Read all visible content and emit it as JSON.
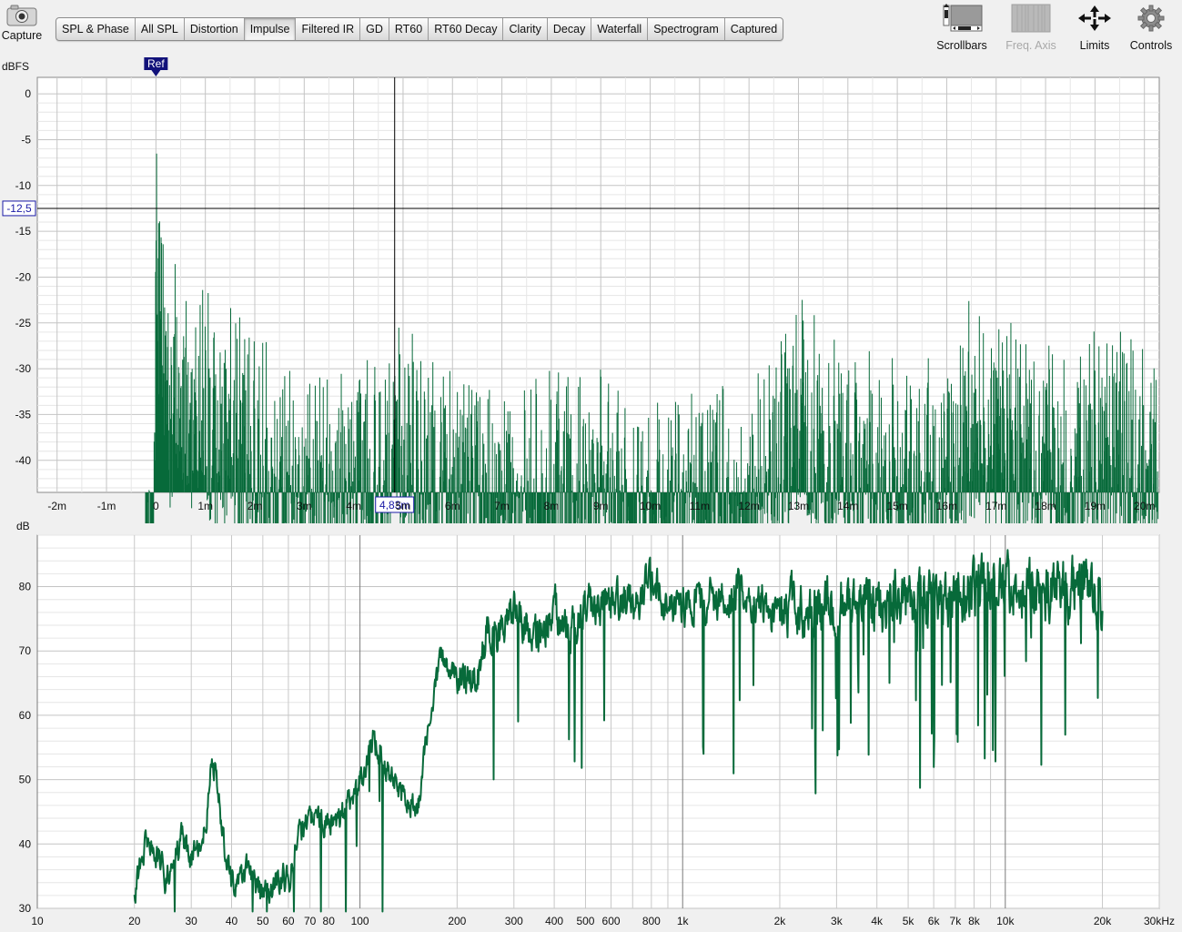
{
  "capture": {
    "label": "Capture"
  },
  "tabs": [
    {
      "label": "SPL & Phase",
      "active": false
    },
    {
      "label": "All SPL",
      "active": false
    },
    {
      "label": "Distortion",
      "active": false
    },
    {
      "label": "Impulse",
      "active": true
    },
    {
      "label": "Filtered IR",
      "active": false
    },
    {
      "label": "GD",
      "active": false
    },
    {
      "label": "RT60",
      "active": false
    },
    {
      "label": "RT60 Decay",
      "active": false
    },
    {
      "label": "Clarity",
      "active": false
    },
    {
      "label": "Decay",
      "active": false
    },
    {
      "label": "Waterfall",
      "active": false
    },
    {
      "label": "Spectrogram",
      "active": false
    },
    {
      "label": "Captured",
      "active": false
    }
  ],
  "tools": {
    "scrollbars": "Scrollbars",
    "freq_axis": "Freq. Axis",
    "limits": "Limits",
    "controls": "Controls"
  },
  "colors": {
    "trace": "#076a3a",
    "grid": "#c8c8c8",
    "cursor": "#000000",
    "marker": "#1a1aa6"
  },
  "chart_data": [
    {
      "type": "area",
      "ylabel": "dBFS",
      "x_ticks": [
        "-2m",
        "-1m",
        "0",
        "1m",
        "2m",
        "3m",
        "4m",
        "5m",
        "6m",
        "7m",
        "8m",
        "9m",
        "10m",
        "11m",
        "12m",
        "13m",
        "14m",
        "15m",
        "16m",
        "17m",
        "18m",
        "19m",
        "20m"
      ],
      "y_ticks": [
        "0",
        "-5",
        "-10",
        "-15",
        "-20",
        "-25",
        "-30",
        "-35",
        "-40"
      ],
      "xlim": [
        -2.4,
        20.3
      ],
      "ylim": [
        -43.5,
        1.8
      ],
      "ref_marker": "Ref",
      "cursor": {
        "x_label": "4,83m",
        "y_label": "-12,5",
        "x": 4.83,
        "y": -12.5
      },
      "envelope": {
        "t": [
          -0.2,
          -0.1,
          -0.02,
          0.0,
          0.05,
          0.1,
          0.2,
          0.3,
          0.5,
          0.7,
          1.0,
          1.2,
          1.5,
          2.0,
          2.5,
          3.0,
          3.5,
          4.0,
          4.5,
          4.9,
          5.5,
          6.0,
          7.0,
          8.0,
          9.0,
          10.0,
          11.0,
          12.0,
          12.5,
          13.1,
          13.5,
          14.0,
          15.0,
          15.5,
          16.0,
          16.4,
          16.8,
          17.5,
          18.0,
          18.5,
          19.0,
          19.5,
          20.0,
          20.3
        ],
        "db": [
          -43,
          -38,
          -20,
          0,
          -6,
          -10,
          -14,
          -20,
          -16,
          -22,
          -17,
          -26,
          -22,
          -26,
          -28,
          -30,
          -29,
          -28,
          -27,
          -24,
          -28,
          -29,
          -31,
          -30,
          -30,
          -33,
          -31,
          -30,
          -27,
          -19,
          -27,
          -26,
          -29,
          -28,
          -28,
          -22,
          -22,
          -26,
          -25,
          -28,
          -24,
          -25,
          -26,
          -27
        ]
      }
    },
    {
      "type": "line",
      "ylabel": "dB",
      "x_scale": "log",
      "x_ticks": [
        "10",
        "20",
        "30",
        "40",
        "50",
        "60",
        "70",
        "80",
        "100",
        "200",
        "300",
        "400",
        "500",
        "600",
        "800",
        "1k",
        "2k",
        "3k",
        "4k",
        "5k",
        "6k",
        "7k",
        "8k",
        "10k",
        "20k",
        "30kHz"
      ],
      "y_ticks": [
        "80",
        "70",
        "60",
        "50",
        "40",
        "30"
      ],
      "xlim": [
        10,
        30000
      ],
      "ylim": [
        30,
        88
      ],
      "envelope": {
        "hz": [
          20,
          22,
          25,
          28,
          30,
          33,
          35,
          38,
          40,
          45,
          50,
          55,
          60,
          65,
          70,
          80,
          90,
          100,
          110,
          120,
          130,
          150,
          170,
          180,
          200,
          230,
          250,
          270,
          300,
          330,
          350,
          400,
          450,
          500,
          600,
          700,
          800,
          900,
          1000,
          1200,
          1500,
          2000,
          2500,
          3000,
          4000,
          5000,
          6000,
          8000,
          10000,
          12000,
          15000,
          18000,
          20000
        ],
        "db": [
          33,
          41,
          35,
          41,
          38,
          42,
          54,
          40,
          34,
          36,
          32,
          35,
          34,
          42,
          44,
          43,
          45,
          50,
          56,
          52,
          50,
          45,
          64,
          69,
          66,
          66,
          74,
          72,
          78,
          73,
          72,
          76,
          74,
          77,
          77,
          78,
          80,
          78,
          77,
          78,
          79,
          76,
          76,
          77,
          77,
          78,
          78,
          79,
          80,
          79,
          79,
          81,
          74
        ]
      }
    }
  ]
}
